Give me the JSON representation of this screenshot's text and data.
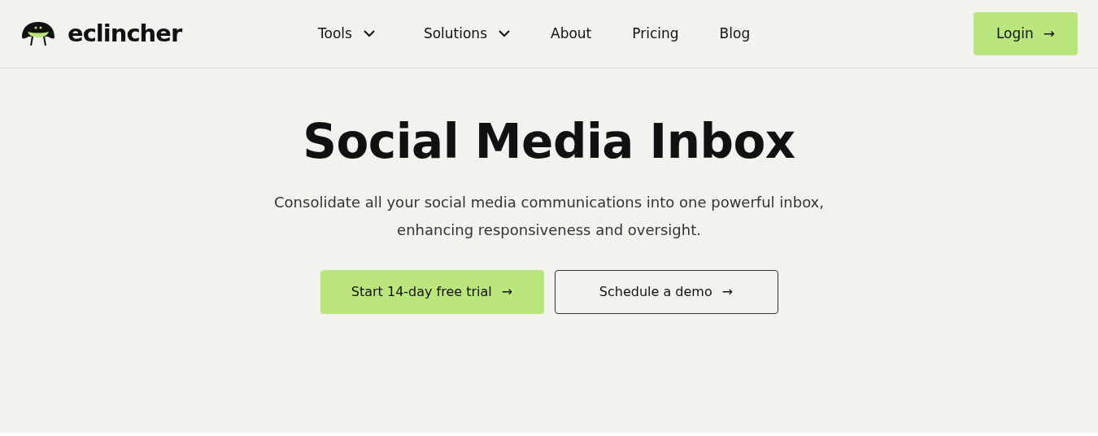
{
  "logo": {
    "text": "eclincher"
  },
  "nav": [
    {
      "label": "Tools",
      "dropdown": true
    },
    {
      "label": "Solutions",
      "dropdown": true
    },
    {
      "label": "About",
      "dropdown": false
    },
    {
      "label": "Pricing",
      "dropdown": false
    },
    {
      "label": "Blog",
      "dropdown": false
    }
  ],
  "login": {
    "label": "Login",
    "arrow": "→"
  },
  "hero": {
    "title": "Social Media Inbox",
    "subtitle": "Consolidate all your social media communications into one powerful inbox, enhancing responsiveness and oversight.",
    "buttons": [
      {
        "label": "Start 14-day free trial",
        "arrow": "→",
        "kind": "primary"
      },
      {
        "label": "Schedule a demo",
        "arrow": "→",
        "kind": "outline"
      }
    ]
  }
}
